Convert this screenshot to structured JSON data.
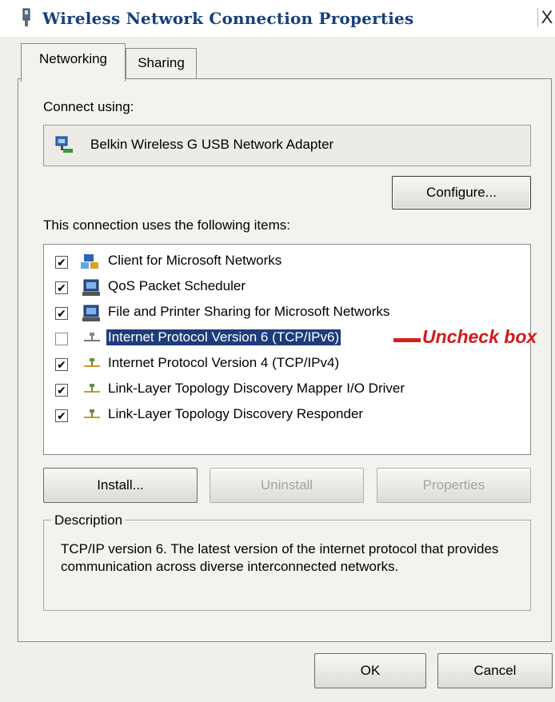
{
  "window": {
    "title": "Wireless Network Connection Properties",
    "close_glyph": "X"
  },
  "tabs": [
    {
      "label": "Networking",
      "active": true
    },
    {
      "label": "Sharing",
      "active": false
    }
  ],
  "connect_using": {
    "label": "Connect using:",
    "adapter": "Belkin Wireless G USB Network Adapter",
    "adapter_icon": "network-adapter-icon",
    "configure_label": "Configure..."
  },
  "items": {
    "label": "This connection uses the following items:",
    "list": [
      {
        "label": "Client for Microsoft Networks",
        "checked": true,
        "icon": "client-icon"
      },
      {
        "label": "QoS Packet Scheduler",
        "checked": true,
        "icon": "service-icon"
      },
      {
        "label": "File and Printer Sharing for Microsoft Networks",
        "checked": true,
        "icon": "service-icon"
      },
      {
        "label": "Internet Protocol Version 6 (TCP/IPv6)",
        "checked": false,
        "selected": true,
        "icon": "protocol-icon"
      },
      {
        "label": "Internet Protocol Version 4 (TCP/IPv4)",
        "checked": true,
        "icon": "protocol-icon"
      },
      {
        "label": "Link-Layer Topology Discovery Mapper I/O Driver",
        "checked": true,
        "icon": "protocol-icon"
      },
      {
        "label": "Link-Layer Topology Discovery Responder",
        "checked": true,
        "icon": "protocol-icon"
      }
    ],
    "check_glyph": "✔"
  },
  "annotation": {
    "text": "Uncheck box",
    "color": "#d91c1c"
  },
  "buttons": {
    "install": "Install...",
    "uninstall": "Uninstall",
    "properties": "Properties",
    "ok": "OK",
    "cancel": "Cancel"
  },
  "description": {
    "title": "Description",
    "text": "TCP/IP version 6. The latest version of the internet protocol that provides communication across diverse interconnected networks."
  },
  "colors": {
    "title": "#17407d",
    "selection": "#1f3c7a",
    "annotation": "#d91c1c"
  }
}
